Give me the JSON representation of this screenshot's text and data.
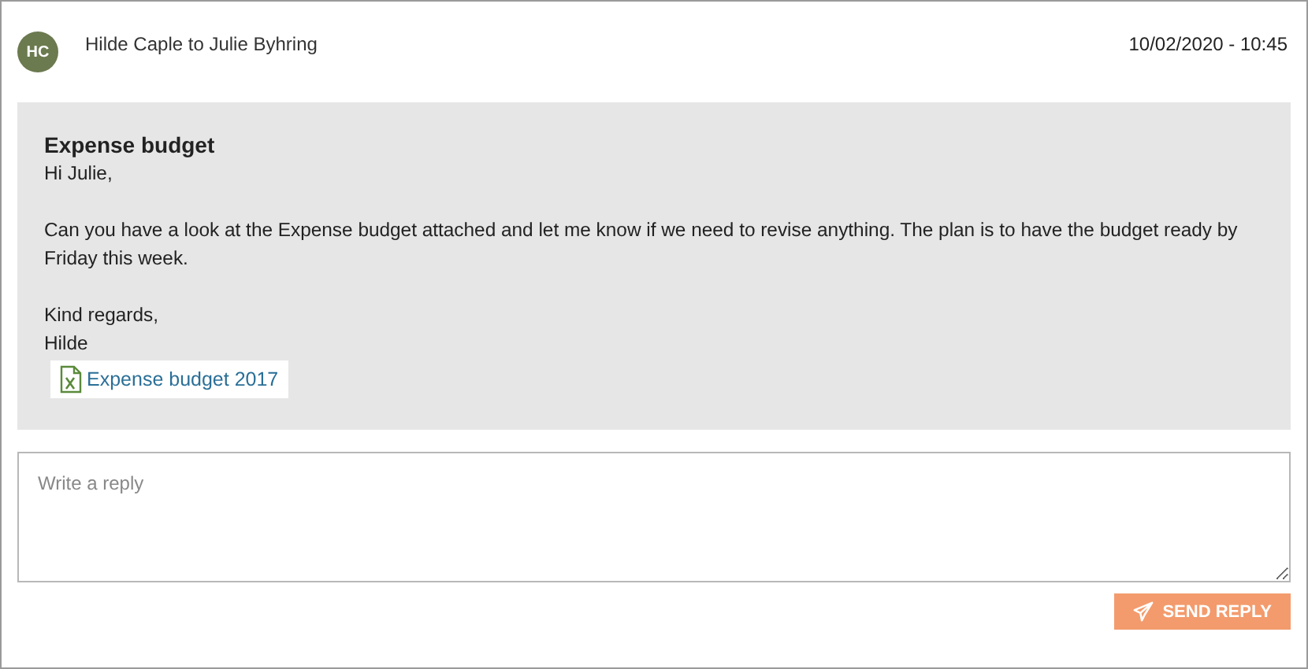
{
  "header": {
    "avatar": "HC",
    "from_to": "Hilde Caple to Julie Byhring",
    "timestamp": "10/02/2020 - 10:45"
  },
  "message": {
    "subject": "Expense budget",
    "paragraphs": [
      [
        "Hi Julie,"
      ],
      [
        "Can you have a look at the Expense budget attached and let me know if we need to revise anything. The plan is to have the budget ready by Friday this week."
      ],
      [
        "Kind regards,",
        "Hilde"
      ]
    ],
    "attachment": {
      "name": "Expense budget 2017"
    }
  },
  "reply": {
    "placeholder": "Write a reply",
    "button": "SEND REPLY"
  }
}
